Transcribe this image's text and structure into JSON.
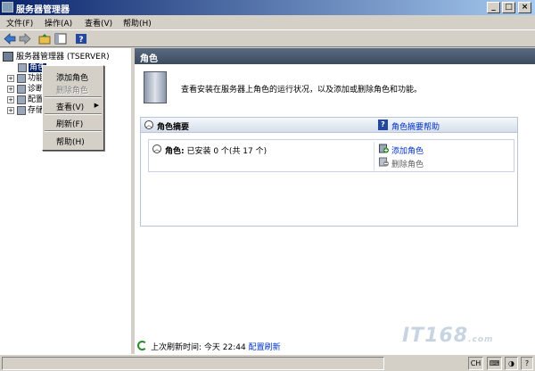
{
  "window": {
    "title": "服务器管理器"
  },
  "menu": {
    "file": "文件(F)",
    "action": "操作(A)",
    "view": "查看(V)",
    "help": "帮助(H)"
  },
  "tree": {
    "root": "服务器管理器 (TSERVER)",
    "selected": "角色",
    "nodes": [
      "功能",
      "诊断",
      "配置",
      "存储"
    ]
  },
  "context_menu": {
    "add_role": "添加角色",
    "remove_role": "删除角色",
    "view": "查看(V)",
    "refresh": "刷新(F)",
    "help": "帮助(H)"
  },
  "content": {
    "header": "角色",
    "intro": "查看安装在服务器上角色的运行状况，以及添加或删除角色和功能。",
    "section_title": "角色摘要",
    "section_help": "角色摘要帮助",
    "roles_label": "角色:",
    "roles_status": "已安装 0 个(共 17 个)",
    "add_roles": "添加角色",
    "remove_roles": "删除角色"
  },
  "refresh": {
    "label": "上次刷新时间: 今天 22:44",
    "link": "配置刷新"
  },
  "watermark": {
    "brand": "IT168",
    "suffix": ".com"
  },
  "statusbar": {
    "lang": "CH"
  },
  "colors": {
    "title_bar": "#0a246a",
    "header": "#3c4a5e",
    "link": "#0033cc",
    "selection": "#0a246a"
  }
}
